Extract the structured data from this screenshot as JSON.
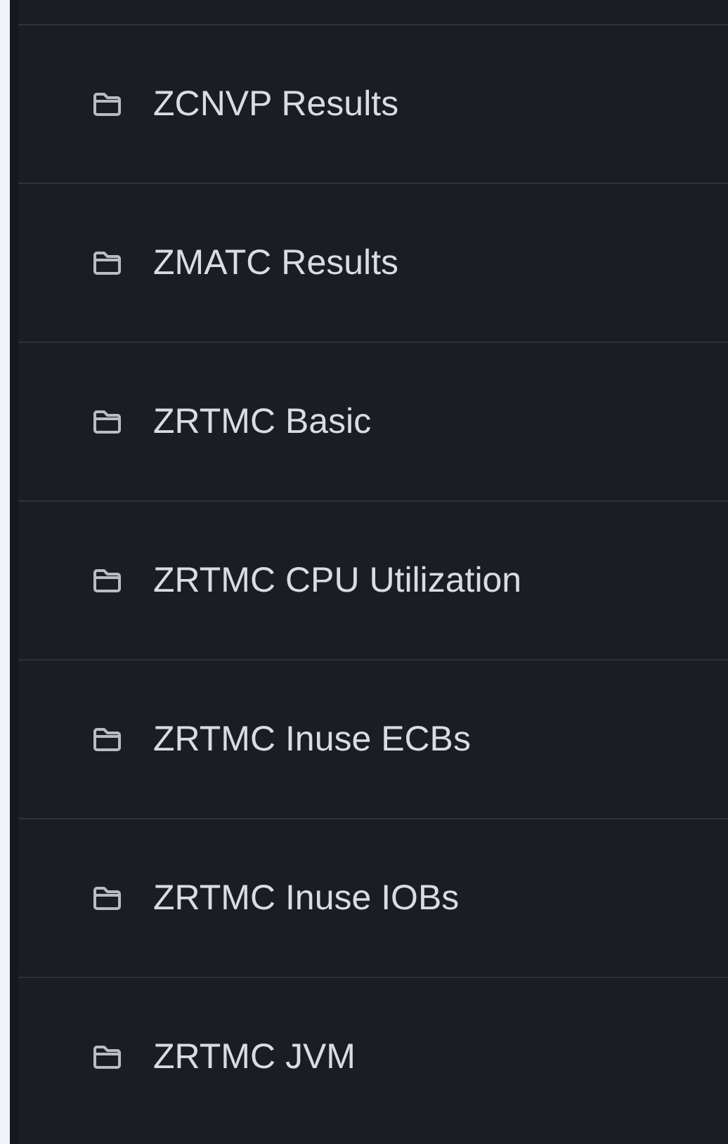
{
  "folders": [
    {
      "label": "ZCNVP Results"
    },
    {
      "label": "ZMATC Results"
    },
    {
      "label": "ZRTMC Basic"
    },
    {
      "label": "ZRTMC CPU Utilization"
    },
    {
      "label": "ZRTMC Inuse ECBs"
    },
    {
      "label": "ZRTMC Inuse IOBs"
    },
    {
      "label": "ZRTMC JVM"
    }
  ]
}
